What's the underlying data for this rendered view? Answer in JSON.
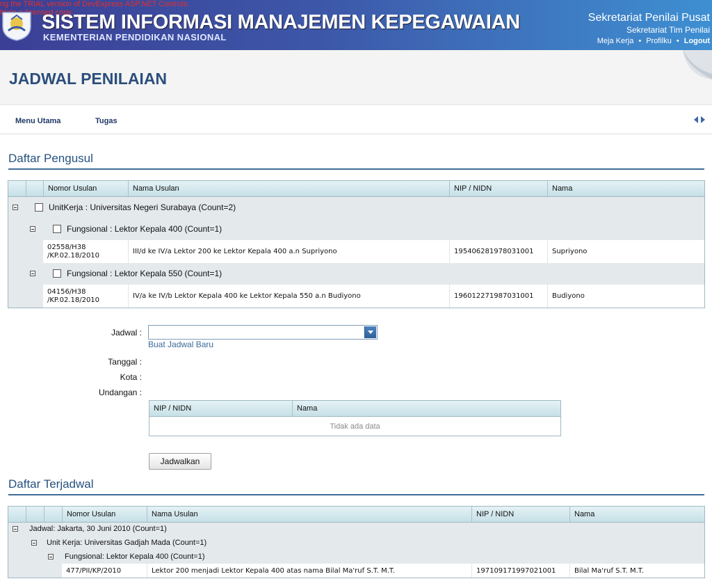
{
  "banner": {
    "trial_line1": "ng the TRIAL version of DevExpress ASP.NET Controls.",
    "trial_line2": "btain a licensed copy.",
    "app_title": "SISTEM INFORMASI MANAJEMEN KEPEGAWAIAN",
    "app_subtitle": "KEMENTERIAN PENDIDIKAN NASIONAL",
    "org_primary": "Sekretariat Penilai Pusat",
    "org_secondary": "Sekretariat Tim Penilai",
    "links": {
      "meja_kerja": "Meja Kerja",
      "separator": "•",
      "profilku": "Profilku",
      "logout": "Logout"
    },
    "logo_icon": "tut-wuri-handayani-logo"
  },
  "page": {
    "title": "JADWAL PENILAIAN"
  },
  "menu": {
    "items": [
      "Menu Utama",
      "Tugas"
    ],
    "nav_icons": [
      "arrow-left-icon",
      "arrow-right-icon"
    ]
  },
  "daftar_pengusul": {
    "title": "Daftar Pengusul",
    "columns": [
      "Nomor Usulan",
      "Nama Usulan",
      "NIP / NIDN",
      "Nama"
    ],
    "group1": "UnitKerja : Universitas Negeri Surabaya (Count=2)",
    "subgroups": [
      {
        "label": "Fungsional : Lektor Kepala 400 (Count=1)",
        "row": {
          "nomor_l1": "02558/H38",
          "nomor_l2": "/KP.02.18/2010",
          "nama_usulan": "III/d ke IV/a Lektor 200 ke Lektor Kepala 400 a.n Supriyono",
          "nip": "195406281978031001",
          "nama": "Supriyono"
        }
      },
      {
        "label": "Fungsional : Lektor Kepala 550 (Count=1)",
        "row": {
          "nomor_l1": "04156/H38",
          "nomor_l2": "/KP.02.18/2010",
          "nama_usulan": "IV/a ke IV/b Lektor Kepala 400 ke Lektor Kepala 550 a.n Budiyono",
          "nip": "196012271987031001",
          "nama": "Budiyono"
        }
      }
    ]
  },
  "form": {
    "jadwal_label": "Jadwal :",
    "jadwal_value": "",
    "buat_jadwal_link": "Buat Jadwal Baru",
    "tanggal_label": "Tanggal :",
    "kota_label": "Kota :",
    "undangan_label": "Undangan :",
    "undangan_columns": [
      "NIP / NIDN",
      "Nama"
    ],
    "undangan_empty": "Tidak ada data",
    "jadwalkan_button": "Jadwalkan"
  },
  "daftar_terjadwal": {
    "title": "Daftar Terjadwal",
    "columns": [
      "Nomor Usulan",
      "Nama Usulan",
      "NIP / NIDN",
      "Nama"
    ],
    "group1": "Jadwal: Jakarta, 30 Juni 2010 (Count=1)",
    "group2": "Unit Kerja: Universitas Gadjah Mada (Count=1)",
    "group3": "Fungsional: Lektor Kepala 400 (Count=1)",
    "row": {
      "nomor": "477/PII/KP/2010",
      "nama_usulan": "Lektor 200 menjadi Lektor Kepala 400 atas nama Bilal Ma'ruf S.T. M.T.",
      "nip": "197109171997021001",
      "nama": "Bilal Ma'ruf S.T. M.T."
    }
  },
  "colors": {
    "banner_start": "#3b3f95",
    "banner_end": "#3e8fd2",
    "title_blue": "#2b4e7c",
    "section_line": "#3e6c97",
    "grid_header": "#c6e0e7",
    "group_row": "#e4e9ec"
  }
}
